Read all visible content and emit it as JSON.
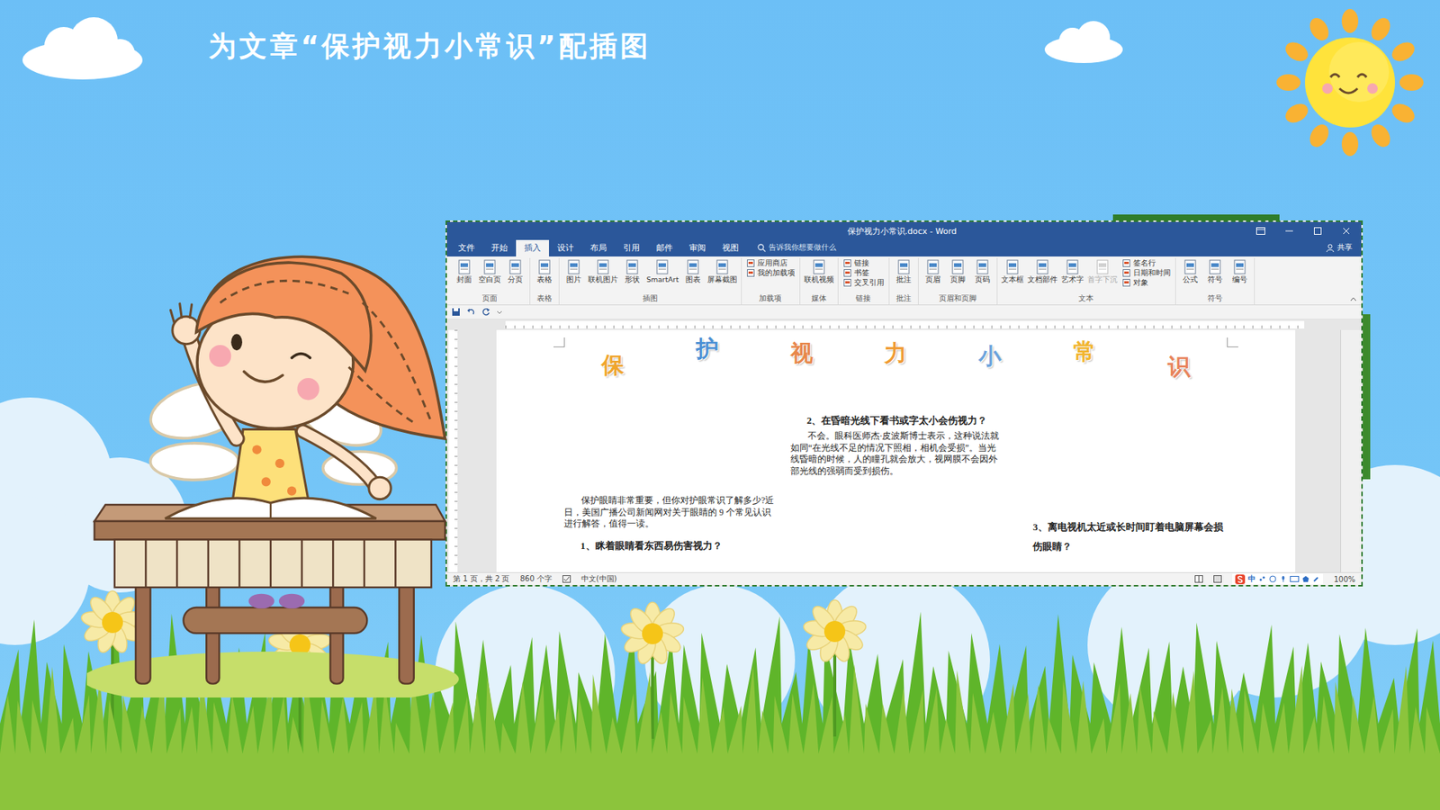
{
  "slide": {
    "title": "为文章“保护视力小常识”配插图"
  },
  "window": {
    "title": "保护视力小常识.docx - Word"
  },
  "tabs": [
    {
      "label": "文件",
      "selected": false
    },
    {
      "label": "开始",
      "selected": false
    },
    {
      "label": "插入",
      "selected": true
    },
    {
      "label": "设计",
      "selected": false
    },
    {
      "label": "布局",
      "selected": false
    },
    {
      "label": "引用",
      "selected": false
    },
    {
      "label": "邮件",
      "selected": false
    },
    {
      "label": "审阅",
      "selected": false
    },
    {
      "label": "视图",
      "selected": false
    }
  ],
  "search": {
    "placeholder": "告诉我你想要做什么"
  },
  "share": "共享",
  "ribbon": [
    {
      "label": "页面",
      "items": [
        {
          "label": "封面",
          "kind": "large",
          "disabled": false
        },
        {
          "label": "空白页",
          "kind": "large",
          "disabled": false
        },
        {
          "label": "分页",
          "kind": "large",
          "disabled": false
        }
      ]
    },
    {
      "label": "表格",
      "items": [
        {
          "label": "表格",
          "kind": "large",
          "disabled": false
        }
      ]
    },
    {
      "label": "插图",
      "items": [
        {
          "label": "图片",
          "kind": "large",
          "disabled": false
        },
        {
          "label": "联机图片",
          "kind": "large",
          "disabled": false
        },
        {
          "label": "形状",
          "kind": "large",
          "disabled": false
        },
        {
          "label": "SmartArt",
          "kind": "large",
          "disabled": false
        },
        {
          "label": "图表",
          "kind": "large",
          "disabled": false
        },
        {
          "label": "屏幕截图",
          "kind": "large",
          "disabled": false
        }
      ]
    },
    {
      "label": "加载项",
      "items": [
        {
          "label": "应用商店",
          "kind": "small",
          "disabled": false
        },
        {
          "label": "我的加载项",
          "kind": "small",
          "disabled": false
        }
      ]
    },
    {
      "label": "媒体",
      "items": [
        {
          "label": "联机视频",
          "kind": "large",
          "disabled": false
        }
      ]
    },
    {
      "label": "链接",
      "items": [
        {
          "label": "链接",
          "kind": "small",
          "disabled": false
        },
        {
          "label": "书签",
          "kind": "small",
          "disabled": false
        },
        {
          "label": "交叉引用",
          "kind": "small",
          "disabled": false
        }
      ]
    },
    {
      "label": "批注",
      "items": [
        {
          "label": "批注",
          "kind": "large",
          "disabled": false
        }
      ]
    },
    {
      "label": "页眉和页脚",
      "items": [
        {
          "label": "页眉",
          "kind": "large",
          "disabled": false
        },
        {
          "label": "页脚",
          "kind": "large",
          "disabled": false
        },
        {
          "label": "页码",
          "kind": "large",
          "disabled": false
        }
      ]
    },
    {
      "label": "文本",
      "items": [
        {
          "label": "文本框",
          "kind": "large",
          "disabled": false
        },
        {
          "label": "文档部件",
          "kind": "large",
          "disabled": false
        },
        {
          "label": "艺术字",
          "kind": "large",
          "disabled": false
        },
        {
          "label": "首字下沉",
          "kind": "large",
          "disabled": true
        },
        {
          "label": "签名行",
          "kind": "small",
          "disabled": false
        },
        {
          "label": "日期和时间",
          "kind": "small",
          "disabled": false
        },
        {
          "label": "对象",
          "kind": "small",
          "disabled": false
        }
      ]
    },
    {
      "label": "符号",
      "items": [
        {
          "label": "公式",
          "kind": "large",
          "disabled": false
        },
        {
          "label": "符号",
          "kind": "large",
          "disabled": false
        },
        {
          "label": "编号",
          "kind": "large",
          "disabled": false
        }
      ]
    }
  ],
  "document": {
    "wordart": [
      {
        "char": "保",
        "color": "#f0a52c"
      },
      {
        "char": "护",
        "color": "#4a8fd4"
      },
      {
        "char": "视",
        "color": "#e8874a"
      },
      {
        "char": "力",
        "color": "#f09a30"
      },
      {
        "char": "小",
        "color": "#6aa2dc"
      },
      {
        "char": "常",
        "color": "#f2b52e"
      },
      {
        "char": "识",
        "color": "#e8835a"
      }
    ],
    "columns": [
      {
        "blocks": [
          {
            "kind": "paragraph",
            "text": "保护眼睛非常重要，但你对护眼常识了解多少?近日，美国广播公司新闻网对关于眼睛的 9 个常见认识进行解答，值得一读。"
          },
          {
            "kind": "heading",
            "text": "1、眯着眼睛看东西易伤害视力？"
          }
        ]
      },
      {
        "blocks": [
          {
            "kind": "heading",
            "text": "2、在昏暗光线下看书或字太小会伤视力？"
          },
          {
            "kind": "paragraph",
            "text": "不会。眼科医师杰·皮波斯博士表示，这种说法就如同“在光线不足的情况下照相，相机会受损”。当光线昏暗的时候，人的瞳孔就会放大，视网膜不会因外部光线的强弱而受到损伤。"
          }
        ]
      },
      {
        "blocks": [
          {
            "kind": "heading",
            "text": "3、离电视机太近或长时间盯着电脑屏幕会损伤眼睛？"
          }
        ]
      }
    ]
  },
  "status_bar": {
    "page": "第 1 页，共 2 页",
    "words": "860 个字",
    "language": "中文(中国)",
    "ime": "中",
    "zoom": "100%"
  }
}
